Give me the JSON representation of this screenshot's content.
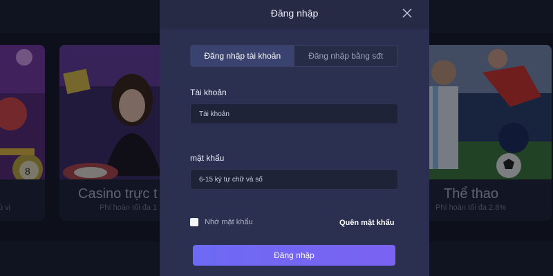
{
  "background": {
    "cards": [
      {
        "title": "",
        "subtitle": "ủ vị"
      },
      {
        "title": "Casino trực t",
        "subtitle": "Phí hoàn tối đa 1"
      },
      {
        "title": "Thể thao",
        "subtitle": "Phí hoàn tối đa 2.8%"
      }
    ]
  },
  "modal": {
    "title": "Đăng nhập",
    "tabs": [
      {
        "label": "Đăng nhập tài khoản",
        "active": true
      },
      {
        "label": "Đăng nhập bằng sđt",
        "active": false
      }
    ],
    "account": {
      "label": "Tài khoản",
      "placeholder": "Tài khoản"
    },
    "password": {
      "label": "mật khẩu",
      "placeholder": "6-15 ký tự chữ và số"
    },
    "remember": {
      "label": "Nhớ mật khẩu",
      "checked": false
    },
    "forgot_label": "Quên mật khẩu",
    "submit_label": "Đăng nhập"
  },
  "colors": {
    "accent": "#6d6af4",
    "modal_bg": "#2b3050",
    "page_bg": "#151826"
  }
}
